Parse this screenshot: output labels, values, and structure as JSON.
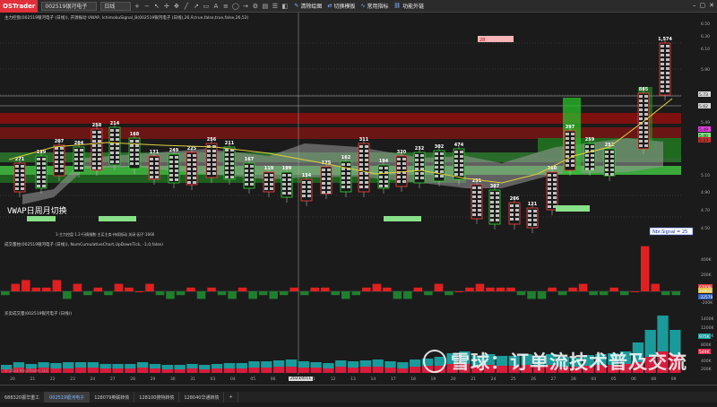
{
  "toolbar": {
    "logo": "OSTrader",
    "instrument": "002519银河电子",
    "timeframe": "日线",
    "btn_drawing": "清除绘图",
    "btn_switch": "切换模板",
    "btn_indicators": "常用指标",
    "btn_plugins": "功能外链"
  },
  "panel1": {
    "title": "主力控盘(002519银河电子 (日线)), 开源振动 VWAP, IchimokuSignal_B(002519银河电子 (日线),26,9,true,false,true,false,26,52)",
    "subtitle": "1-主力控盘 1.2-行情指数-主买主卖-持续振动 关闭-因子:1666",
    "vwap_label": "VWAP日周月切换",
    "signal_badge": "Nbr.Signal = 25",
    "pink_marker": "28",
    "volume_labels": [
      "271",
      "199",
      "207",
      "204",
      "258",
      "214",
      "168",
      "171",
      "249",
      "225",
      "256",
      "211",
      "167",
      "119",
      "199",
      "154",
      "175",
      "162",
      "311",
      "194",
      "320",
      "232",
      "302",
      "474",
      "251",
      "307",
      "206",
      "121",
      "260",
      "397",
      "259",
      "252",
      "885",
      "1,574",
      "950"
    ],
    "price_ticks": [
      "6.50",
      "6.30",
      "6.10",
      "5.90",
      "5.73",
      "5.62",
      "5.49",
      "5.40",
      "5.33",
      "5.10",
      "4.90",
      "4.70",
      "4.50"
    ],
    "price_tags": [
      {
        "text": "5.73",
        "color": "#d8d8d8"
      },
      {
        "text": "5.62",
        "color": "#d8d8d8"
      },
      {
        "text": "5.49",
        "color": "#e040e0"
      },
      {
        "text": "5.40",
        "color": "#7fe07f"
      },
      {
        "text": "5.33",
        "color": "#c03030"
      }
    ]
  },
  "panel2": {
    "title": "成交量柱(002519银河电子 (日线)), NumCumulativeChart,UpDownTick, -1,0,false)",
    "ticks": [
      "400K",
      "200K",
      "0",
      "-200K"
    ],
    "tags": [
      {
        "text": "67009",
        "color": "#e04040"
      },
      {
        "text": "24803",
        "color": "#e0c040"
      },
      {
        "text": "-32579",
        "color": "#3060c0"
      }
    ]
  },
  "panel3": {
    "title": "买卖成交量(002519银河电子 (日线))",
    "ticks": [
      "1400K",
      "1200K",
      "1000K",
      "800K",
      "600K",
      "400K",
      "200K"
    ],
    "tags": [
      {
        "text": "975K",
        "color": "#20a0a0"
      },
      {
        "text": "549K",
        "color": "#e03050"
      }
    ],
    "copyright": "© 2023 NinjaTrader, LLC"
  },
  "date_axis": {
    "ticks": [
      "20",
      "21",
      "22",
      "23",
      "24",
      "27",
      "28",
      "29",
      "30",
      "31",
      "03",
      "04",
      "05",
      "06",
      "07",
      "11",
      "12",
      "13",
      "14",
      "17",
      "18",
      "19",
      "20",
      "21",
      "24",
      "25",
      "26",
      "27",
      "28",
      "04",
      "05",
      "06",
      "08",
      "09"
    ],
    "cursor_label": "2023/4/11"
  },
  "tabs": [
    {
      "label": "688320振华重工",
      "active": false
    },
    {
      "label": "002519银河电子",
      "active": true
    },
    {
      "label": "128079英联转债",
      "active": false
    },
    {
      "label": "128100搜特转债",
      "active": false
    },
    {
      "label": "128040华通转债",
      "active": false
    },
    {
      "label": "+",
      "active": false
    }
  ],
  "watermark": "雪球：订单流技术普及交流"
}
